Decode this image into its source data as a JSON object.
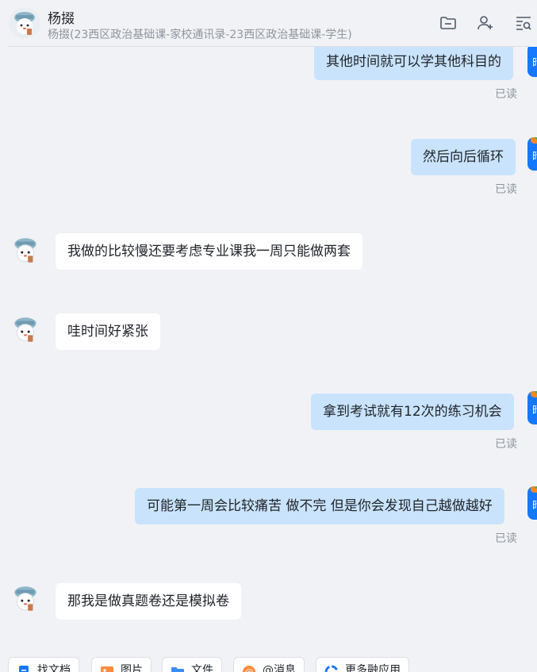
{
  "header": {
    "name": "杨掇",
    "subtitle": "杨掇(23西区政治基础课-家校通讯录-23西区政治基础课-学生)",
    "icons": [
      "folder-icon",
      "add-member-icon",
      "search-history-icon"
    ]
  },
  "colors": {
    "background": "#f1f2f5",
    "my_bubble": "#c9e3fc",
    "their_bubble": "#ffffff",
    "accent": "#1677ff",
    "read_text": "#8f959e"
  },
  "my_avatar_label": "晴",
  "messages": [
    {
      "side": "me",
      "text": "其他时间就可以学其他科目的",
      "status": "已读"
    },
    {
      "side": "me",
      "text": "然后向后循环",
      "status": "已读"
    },
    {
      "side": "them",
      "text": "我做的比较慢还要考虑专业课我一周只能做两套"
    },
    {
      "side": "them",
      "text": "哇时间好紧张"
    },
    {
      "side": "me",
      "text": "拿到考试就有12次的练习机会",
      "status": "已读"
    },
    {
      "side": "me",
      "text": "可能第一周会比较痛苦  做不完 但是你会发现自己越做越好",
      "status": "已读"
    },
    {
      "side": "them",
      "text": "那我是做真题卷还是模拟卷"
    }
  ],
  "toolbar": {
    "buttons": [
      {
        "label": "找文档",
        "icon": "doc-icon"
      },
      {
        "label": "图片",
        "icon": "image-icon"
      },
      {
        "label": "文件",
        "icon": "folder-icon"
      },
      {
        "label": "@消息",
        "icon": "at-icon"
      },
      {
        "label": "更多融应用",
        "icon": "apps-icon"
      }
    ]
  }
}
